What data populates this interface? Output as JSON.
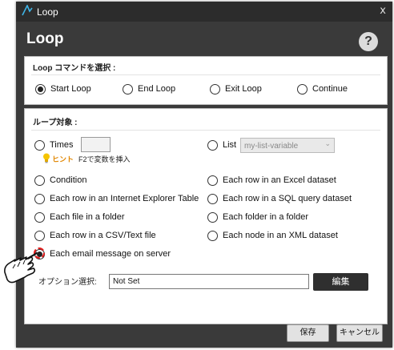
{
  "window": {
    "title": "Loop",
    "close_glyph": "x",
    "heading": "Loop",
    "help_glyph": "?"
  },
  "loop_command": {
    "title": "Loop コマンドを選択 :",
    "options": [
      {
        "label": "Start Loop",
        "selected": true
      },
      {
        "label": "End Loop",
        "selected": false
      },
      {
        "label": "Exit Loop",
        "selected": false
      },
      {
        "label": "Continue",
        "selected": false
      }
    ]
  },
  "loop_target": {
    "title": "ループ対象 :",
    "times_label": "Times",
    "list_label": "List",
    "list_select_value": "my-list-variable",
    "hint_label": "ヒント",
    "hint_text": "F2で変数を挿入",
    "options_left": [
      "Condition",
      "Each row in an Internet Explorer Table",
      "Each file in a folder",
      "Each row in a CSV/Text file",
      "Each email message on server"
    ],
    "options_right": [
      "Each row in an Excel dataset",
      "Each row in a SQL query dataset",
      "Each folder in a folder",
      "Each node in an XML dataset"
    ],
    "selected": "Each email message on server"
  },
  "option_select": {
    "label": "オプション選択:",
    "value": "Not Set",
    "edit_button": "編集"
  },
  "footer": {
    "save_button": "保存",
    "cancel_button": "キャンセル"
  },
  "colors": {
    "window_bg": "#3a3a3a",
    "titlebar_bg": "#2c2c2c",
    "hint_accent": "#e18600",
    "annotation_red": "#e41c1c"
  },
  "icons": [
    "app-logo-icon",
    "close-icon",
    "help-icon",
    "lightbulb-icon",
    "chevron-down-icon",
    "pointing-hand-icon"
  ]
}
